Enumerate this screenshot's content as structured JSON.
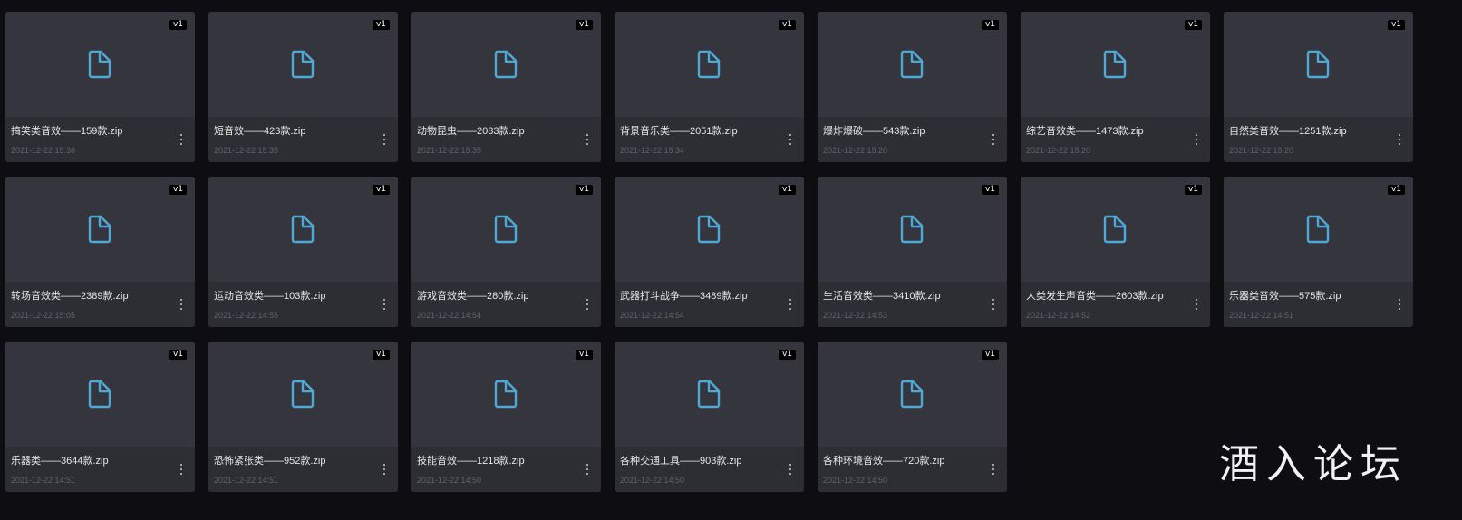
{
  "files": [
    {
      "name": "搞笑类音效——159款.zip",
      "time": "2021-12-22 15:36",
      "version": "v1"
    },
    {
      "name": "短音效——423款.zip",
      "time": "2021-12-22 15:35",
      "version": "v1"
    },
    {
      "name": "动物昆虫——2083款.zip",
      "time": "2021-12-22 15:35",
      "version": "v1"
    },
    {
      "name": "背景音乐类——2051款.zip",
      "time": "2021-12-22 15:34",
      "version": "v1"
    },
    {
      "name": "爆炸爆破——543款.zip",
      "time": "2021-12-22 15:20",
      "version": "v1"
    },
    {
      "name": "综艺音效类——1473款.zip",
      "time": "2021-12-22 15:20",
      "version": "v1"
    },
    {
      "name": "自然类音效——1251款.zip",
      "time": "2021-12-22 15:20",
      "version": "v1"
    },
    {
      "name": "转场音效类——2389款.zip",
      "time": "2021-12-22 15:05",
      "version": "v1"
    },
    {
      "name": "运动音效类——103款.zip",
      "time": "2021-12-22 14:55",
      "version": "v1"
    },
    {
      "name": "游戏音效类——280款.zip",
      "time": "2021-12-22 14:54",
      "version": "v1"
    },
    {
      "name": "武器打斗战争——3489款.zip",
      "time": "2021-12-22 14:54",
      "version": "v1"
    },
    {
      "name": "生活音效类——3410款.zip",
      "time": "2021-12-22 14:53",
      "version": "v1"
    },
    {
      "name": "人类发生声音类——2603款.zip",
      "time": "2021-12-22 14:52",
      "version": "v1"
    },
    {
      "name": "乐器类音效——575款.zip",
      "time": "2021-12-22 14:51",
      "version": "v1"
    },
    {
      "name": "乐器类——3644款.zip",
      "time": "2021-12-22 14:51",
      "version": "v1"
    },
    {
      "name": "恐怖紧张类——952款.zip",
      "time": "2021-12-22 14:51",
      "version": "v1"
    },
    {
      "name": "技能音效——1218款.zip",
      "time": "2021-12-22 14:50",
      "version": "v1"
    },
    {
      "name": "各种交通工具——903款.zip",
      "time": "2021-12-22 14:50",
      "version": "v1"
    },
    {
      "name": "各种环境音效——720款.zip",
      "time": "2021-12-22 14:50",
      "version": "v1"
    }
  ],
  "icons": {
    "file": "file-icon",
    "more": "more-vertical-icon"
  },
  "colors": {
    "page_background": "#0e0e12",
    "card_background": "#2d2d34",
    "thumbnail_background": "#35353d",
    "file_icon": "#4fa9d6",
    "name_text": "#e6e6e6",
    "time_text": "#62626a"
  },
  "watermark": "酒入论坛"
}
